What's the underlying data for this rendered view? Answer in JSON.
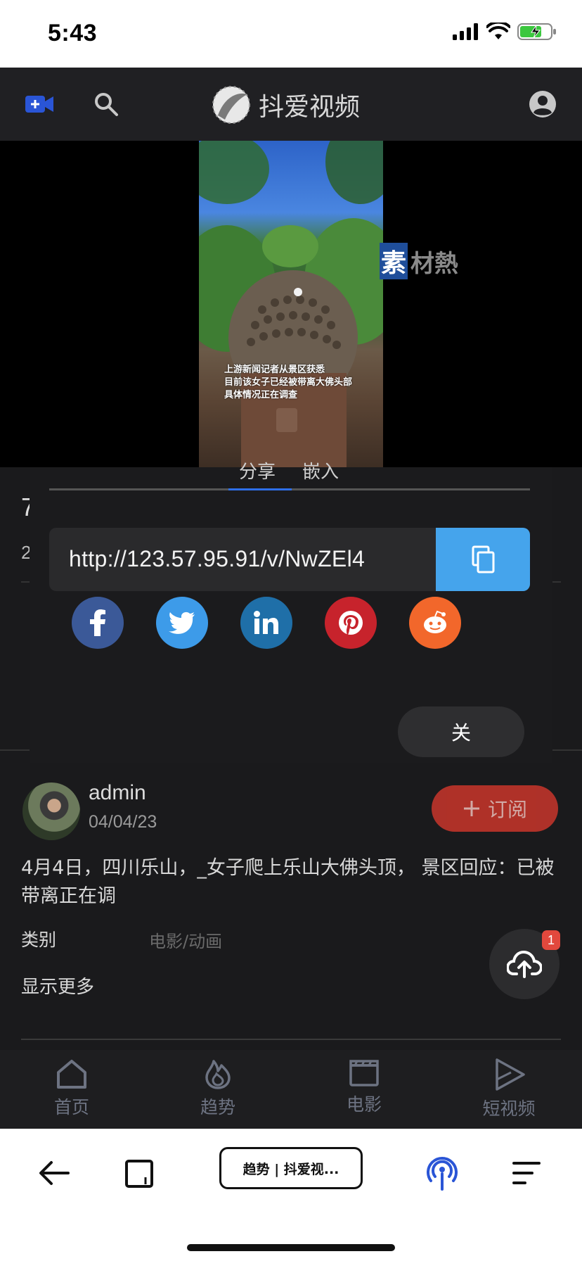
{
  "status_bar": {
    "time": "5:43"
  },
  "header": {
    "logo_text": "抖爱视频"
  },
  "video": {
    "caption_lines": [
      "上游新闻记者从景区获悉",
      "目前该女子已经被带离大佛头部",
      "具体情况正在调查"
    ],
    "watermark_char": "素",
    "watermark_text": "材熱"
  },
  "underlying": {
    "title_char": "7",
    "num": "2"
  },
  "share_modal": {
    "tab_left": "分享",
    "tab_right": "嵌入",
    "url": "http://123.57.95.91/v/NwZEl4",
    "social": [
      "facebook",
      "twitter",
      "linkedin",
      "pinterest",
      "reddit"
    ],
    "close_label": "关",
    "colors": {
      "facebook": "#3b5998",
      "twitter": "#3d9be9",
      "linkedin": "#1f6fa8",
      "pinterest": "#c7232c",
      "reddit": "#f2672b",
      "copy": "#45a4ec"
    }
  },
  "author": {
    "name": "admin",
    "date": "04/04/23",
    "subscribe_label": "订阅"
  },
  "description": "4月4日，四川乐山，_女子爬上乐山大佛头顶， 景区回应：已被带离正在调",
  "category": {
    "label": "类别",
    "value": "电影/动画"
  },
  "show_more": "显示更多",
  "upload_badge": "1",
  "bottom_nav": [
    {
      "label": "首页",
      "icon": "home-icon"
    },
    {
      "label": "趋势",
      "icon": "flame-icon"
    },
    {
      "label": "电影",
      "icon": "clapperboard-icon"
    },
    {
      "label": "短视频",
      "icon": "shorts-play-icon"
    }
  ],
  "browser": {
    "tab_title": "趋势 | 抖爱视..."
  }
}
